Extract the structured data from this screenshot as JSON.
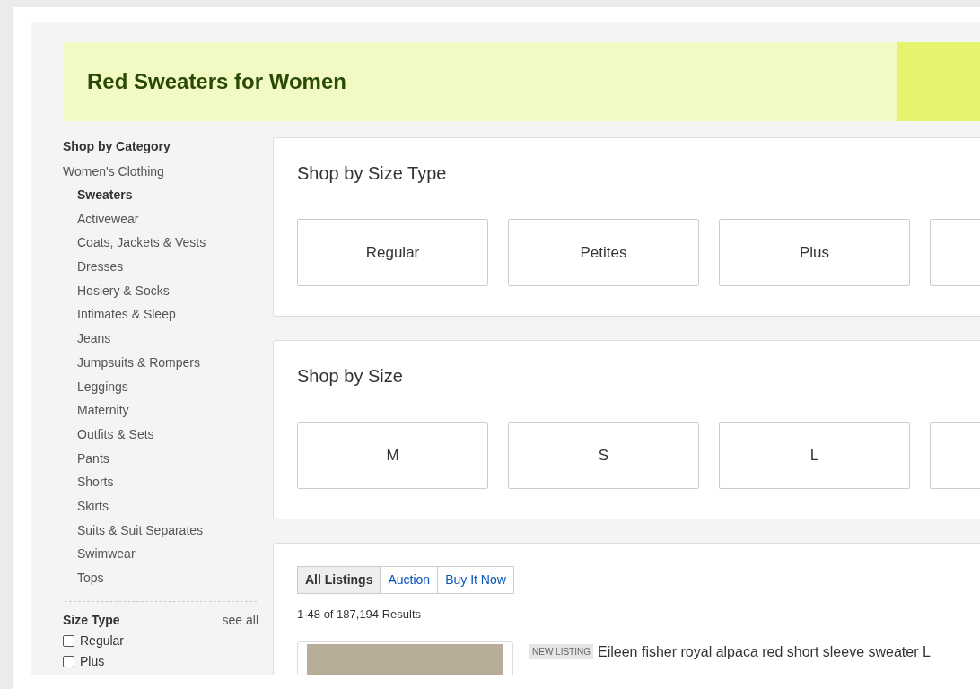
{
  "banner": {
    "title": "Red Sweaters for Women"
  },
  "sidebar": {
    "heading": "Shop by Category",
    "parent": "Women's Clothing",
    "items": [
      {
        "label": "Sweaters",
        "selected": true
      },
      {
        "label": "Activewear",
        "selected": false
      },
      {
        "label": "Coats, Jackets & Vests",
        "selected": false
      },
      {
        "label": "Dresses",
        "selected": false
      },
      {
        "label": "Hosiery & Socks",
        "selected": false
      },
      {
        "label": "Intimates & Sleep",
        "selected": false
      },
      {
        "label": "Jeans",
        "selected": false
      },
      {
        "label": "Jumpsuits & Rompers",
        "selected": false
      },
      {
        "label": "Leggings",
        "selected": false
      },
      {
        "label": "Maternity",
        "selected": false
      },
      {
        "label": "Outfits & Sets",
        "selected": false
      },
      {
        "label": "Pants",
        "selected": false
      },
      {
        "label": "Shorts",
        "selected": false
      },
      {
        "label": "Skirts",
        "selected": false
      },
      {
        "label": "Suits & Suit Separates",
        "selected": false
      },
      {
        "label": "Swimwear",
        "selected": false
      },
      {
        "label": "Tops",
        "selected": false
      }
    ],
    "filter": {
      "heading": "Size Type",
      "see_all": "see all",
      "options": [
        {
          "label": "Regular",
          "checked": false
        },
        {
          "label": "Plus",
          "checked": false
        }
      ]
    }
  },
  "sections": [
    {
      "title": "Shop by Size Type",
      "options": [
        "Regular",
        "Petites",
        "Plus"
      ]
    },
    {
      "title": "Shop by Size",
      "options": [
        "M",
        "S",
        "L"
      ]
    }
  ],
  "listings": {
    "tabs": [
      {
        "label": "All Listings",
        "selected": true
      },
      {
        "label": "Auction",
        "selected": false
      },
      {
        "label": "Buy It Now",
        "selected": false
      }
    ],
    "count": "1-48 of 187,194 Results",
    "items": [
      {
        "badge": "NEW LISTING",
        "title": "Eileen fisher royal alpaca red short sleeve sweater L"
      }
    ]
  }
}
